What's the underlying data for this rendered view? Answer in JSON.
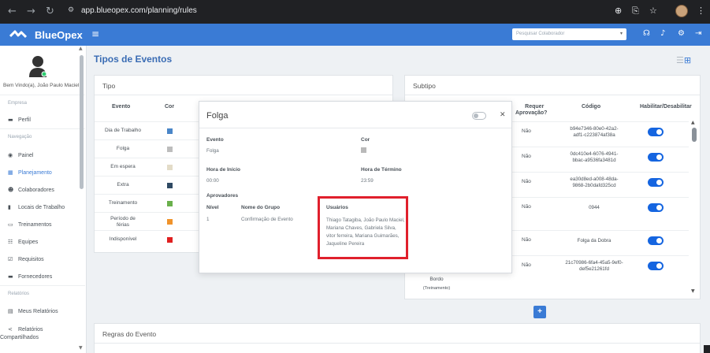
{
  "browser": {
    "url": "app.blueopex.com/planning/rules",
    "icons": [
      "back-icon",
      "forward-icon",
      "reload-icon",
      "site-info-icon",
      "zoom-icon",
      "cast-icon",
      "star-icon",
      "profile-avatar",
      "menu-dots-icon"
    ]
  },
  "app": {
    "brand": "BlueOpex",
    "search_placeholder": "Pesquisar Colaborador",
    "accent": "#3a7bd5"
  },
  "sidebar": {
    "welcome": "Bem Vindo(a), João Paulo Maciel",
    "sections": {
      "empresa": "Empresa",
      "navegacao": "Navegação",
      "relatorios": "Relatórios"
    },
    "items": {
      "perfil": "Perfil",
      "painel": "Painel",
      "planejamento": "Planejamento",
      "colaboradores": "Colaboradores",
      "locais": "Locais de Trabalho",
      "treinamentos": "Treinamentos",
      "equipes": "Equipes",
      "requisitos": "Requisitos",
      "fornecedores": "Fornecedores",
      "meus_relatorios": "Meus Relatórios",
      "relatorios_compartilhados_1": "Relatórios",
      "relatorios_compartilhados_2": "Compartilhados"
    }
  },
  "main": {
    "title": "Tipos de Eventos",
    "tipo": {
      "title": "Tipo",
      "headers": {
        "evento": "Evento",
        "cor": "Cor"
      },
      "rows": [
        {
          "name_1": "Dia de Trabalho",
          "name_2": "",
          "color": "#4a86c8"
        },
        {
          "name_1": "Folga",
          "name_2": "",
          "color": "#bdbdbd"
        },
        {
          "name_1": "Em espera",
          "name_2": "",
          "color": "#e3dcc8"
        },
        {
          "name_1": "Extra",
          "name_2": "",
          "color": "#2f4a63"
        },
        {
          "name_1": "Treinamento",
          "name_2": "",
          "color": "#6ab04c"
        },
        {
          "name_1": "Período de",
          "name_2": "férias",
          "color": "#f0932b"
        },
        {
          "name_1": "Indisponível",
          "name_2": "",
          "color": "#e02020"
        }
      ]
    },
    "subtipo": {
      "title": "Subtipo",
      "headers": {
        "requer_1": "Requer",
        "requer_2": "Aprovação?",
        "codigo": "Código",
        "habilitar": "Habilitar/Desabilitar"
      },
      "rows": [
        {
          "requer": "Não",
          "code_1": "b94e7346-80e0-42a2-",
          "code_2": "adf1-c223874af38a",
          "enabled": true
        },
        {
          "requer": "Não",
          "code_1": "0dc410e4-6076-4941-",
          "code_2": "bbac-a9536fa3481d",
          "enabled": true
        },
        {
          "requer": "Não",
          "code_1": "ea30d8ed-a008-48da-",
          "code_2": "9868-2b0dafd325cd",
          "enabled": true
        },
        {
          "requer": "Não",
          "code_1": "0944",
          "code_2": "",
          "enabled": true
        },
        {
          "requer": "Não",
          "code_1": "Folga da Dobra",
          "code_2": "",
          "enabled": true
        },
        {
          "requer": "Não",
          "code_1": "21c70986-6fa4-45a5-9ef0-",
          "code_2": "def5e21261fd",
          "enabled": true
        }
      ],
      "partial_left_1": "Bordo",
      "partial_left_2": "(Treinamento)"
    },
    "regras": {
      "title": "Regras do Evento"
    }
  },
  "modal": {
    "title": "Folga",
    "evento_label": "Evento",
    "evento_value": "Folga",
    "cor_label": "Cor",
    "cor_value": "#b9b9b9",
    "inicio_label": "Hora de Início",
    "inicio_value": "00:00",
    "termino_label": "Hora de Término",
    "termino_value": "23:59",
    "aprovadores_label": "Aprovadores",
    "nivel_label": "Nível",
    "grupo_label": "Nome do Grupo",
    "usuarios_label": "Usuários",
    "nivel_value": "1",
    "grupo_value": "Confirmação de Evento",
    "usuarios_value": "Thiago Tatagiba, João Paulo Maciel, Mariana Chaves, Gabriela Silva, vitor ferreira, Mariana Guimarães, Jaqueline Pereira"
  }
}
